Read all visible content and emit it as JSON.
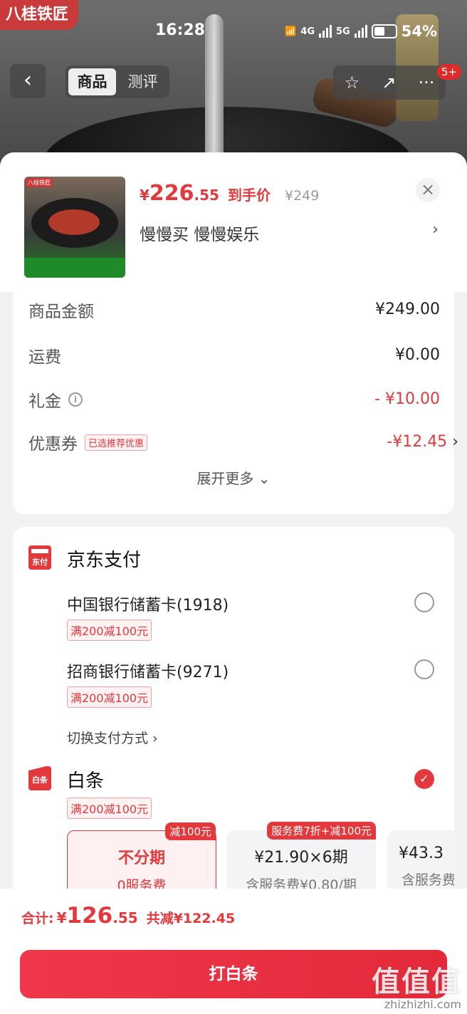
{
  "status_bar": {
    "time": "16:28",
    "signal_4g": "4G",
    "signal_5g": "5G",
    "battery": "54%"
  },
  "hero": {
    "brand_tag": "八桂铁匠"
  },
  "nav": {
    "back": "‹",
    "tabs": [
      "商品",
      "测评"
    ],
    "badge": "5+",
    "star_icon": "☆",
    "share_icon": "↗",
    "more_icon": "···"
  },
  "product": {
    "price_symbol": "¥",
    "price_int": "226",
    "price_dec": ".55",
    "price_tag": "到手价",
    "original_price": "¥249",
    "variant": "慢慢买  慢慢娱乐",
    "close": "×",
    "chevron": "›"
  },
  "fees": [
    {
      "label": "商品金额",
      "value": "¥249.00"
    },
    {
      "label": "运费",
      "value": "¥0.00"
    },
    {
      "label": "礼金",
      "value": "- ¥10.00"
    },
    {
      "label": "优惠券",
      "value": "-¥12.45",
      "tag": "已选推荐优惠"
    }
  ],
  "expand_label": "展开更多",
  "payment": {
    "jd_title": "京东支付",
    "jd_icon_text": "东付",
    "banks": [
      {
        "name": "中国银行储蓄卡(1918)",
        "promo": "满200减100元"
      },
      {
        "name": "招商银行储蓄卡(9271)",
        "promo": "满200减100元"
      }
    ],
    "switch_label": "切换支付方式 ›",
    "baitiao_title": "白条",
    "baitiao_icon_text": "白条",
    "baitiao_promo": "满200减100元",
    "plans": [
      {
        "title": "不分期",
        "sub": "0服务费",
        "badge": "减100元"
      },
      {
        "title": "¥21.90×6期",
        "sub": "含服务费¥0.80/期",
        "badge": "服务费7折+减100元"
      },
      {
        "title": "¥43.3",
        "sub": "含服务费"
      }
    ]
  },
  "bottom": {
    "total_label": "合计:",
    "total_symbol": "¥",
    "total_int": "126",
    "total_dec": ".55",
    "save": "共减¥122.45",
    "pay_button": "打白条"
  },
  "watermark": {
    "big": "值值值",
    "small": "zhizhizhi.com"
  },
  "colors": {
    "accent": "#e4393c",
    "brand_tag": "#c93b3b"
  }
}
